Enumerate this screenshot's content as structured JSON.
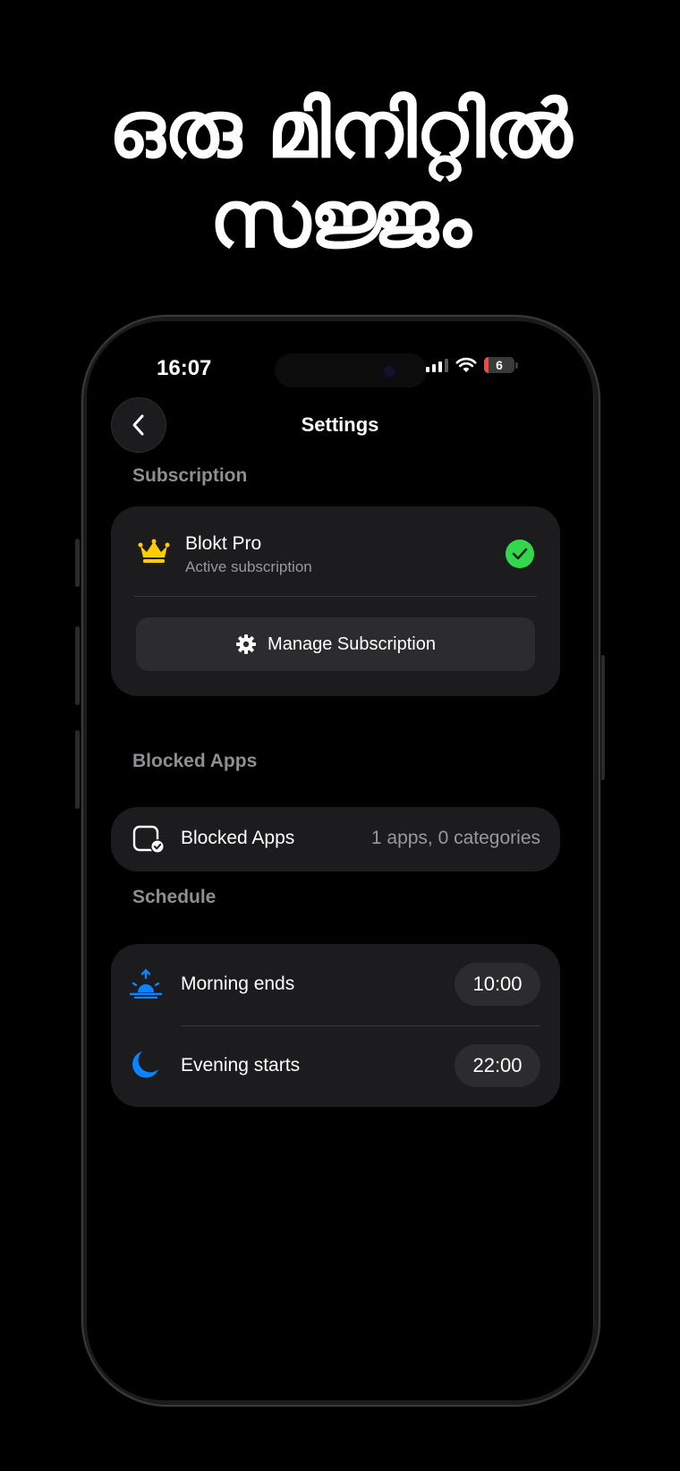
{
  "headline": {
    "line1": "ഒരു മിനിറ്റിൽ",
    "line2": "സജ്ജം"
  },
  "status_bar": {
    "time": "16:07",
    "battery": "6",
    "battery_color": "#ff453a"
  },
  "nav": {
    "title": "Settings",
    "back_icon": "chevron-left-icon"
  },
  "subscription": {
    "section_label": "Subscription",
    "plan_name": "Blokt Pro",
    "plan_status": "Active subscription",
    "crown_color": "#ffcc00",
    "check_color": "#32d74b",
    "manage_label": "Manage Subscription"
  },
  "blocked_apps": {
    "section_label": "Blocked Apps",
    "row_label": "Blocked Apps",
    "row_value": "1 apps, 0 categories"
  },
  "schedule": {
    "section_label": "Schedule",
    "items": [
      {
        "label": "Morning ends",
        "time": "10:00",
        "icon": "sunrise-icon"
      },
      {
        "label": "Evening starts",
        "time": "22:00",
        "icon": "moon-icon"
      }
    ],
    "icon_color": "#0a84ff"
  }
}
